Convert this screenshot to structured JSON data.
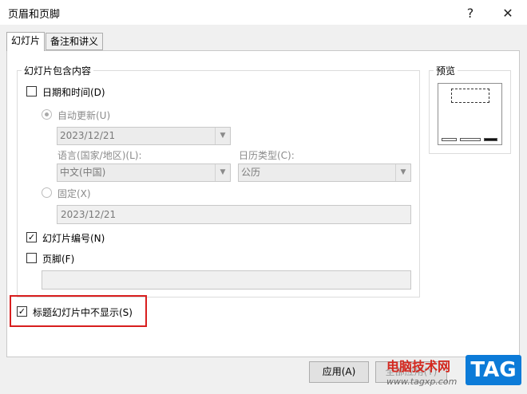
{
  "window": {
    "title": "页眉和页脚",
    "help_glyph": "?",
    "close_glyph": "✕"
  },
  "tabs": [
    {
      "label": "幻灯片",
      "active": true
    },
    {
      "label": "备注和讲义",
      "active": false
    }
  ],
  "content_group": {
    "legend": "幻灯片包含内容"
  },
  "date_time": {
    "label": "日期和时间(D)",
    "checked": false,
    "auto_update": {
      "label": "自动更新(U)",
      "selected": true,
      "value": "2023/12/21"
    },
    "language": {
      "label": "语言(国家/地区)(L):",
      "value": "中文(中国)"
    },
    "calendar": {
      "label": "日历类型(C):",
      "value": "公历"
    },
    "fixed": {
      "label": "固定(X)",
      "selected": false,
      "value": "2023/12/21"
    }
  },
  "slide_number": {
    "label": "幻灯片编号(N)",
    "checked": true
  },
  "footer": {
    "label": "页脚(F)",
    "checked": false,
    "value": ""
  },
  "dont_show_on_title": {
    "label": "标题幻灯片中不显示(S)",
    "checked": true
  },
  "preview": {
    "legend": "预览"
  },
  "buttons": {
    "apply": "应用(A)",
    "apply_all": "全部应用(Y)"
  },
  "check_glyph": "✓",
  "dropdown_glyph": "▼",
  "watermark": {
    "text": "电脑技术网",
    "url": "www.tagxp.com",
    "tag": "TAG"
  },
  "colors": {
    "highlight": "#d81e1e",
    "watermark_text": "#d4281f",
    "watermark_tag_bg": "#0c7bd8"
  }
}
